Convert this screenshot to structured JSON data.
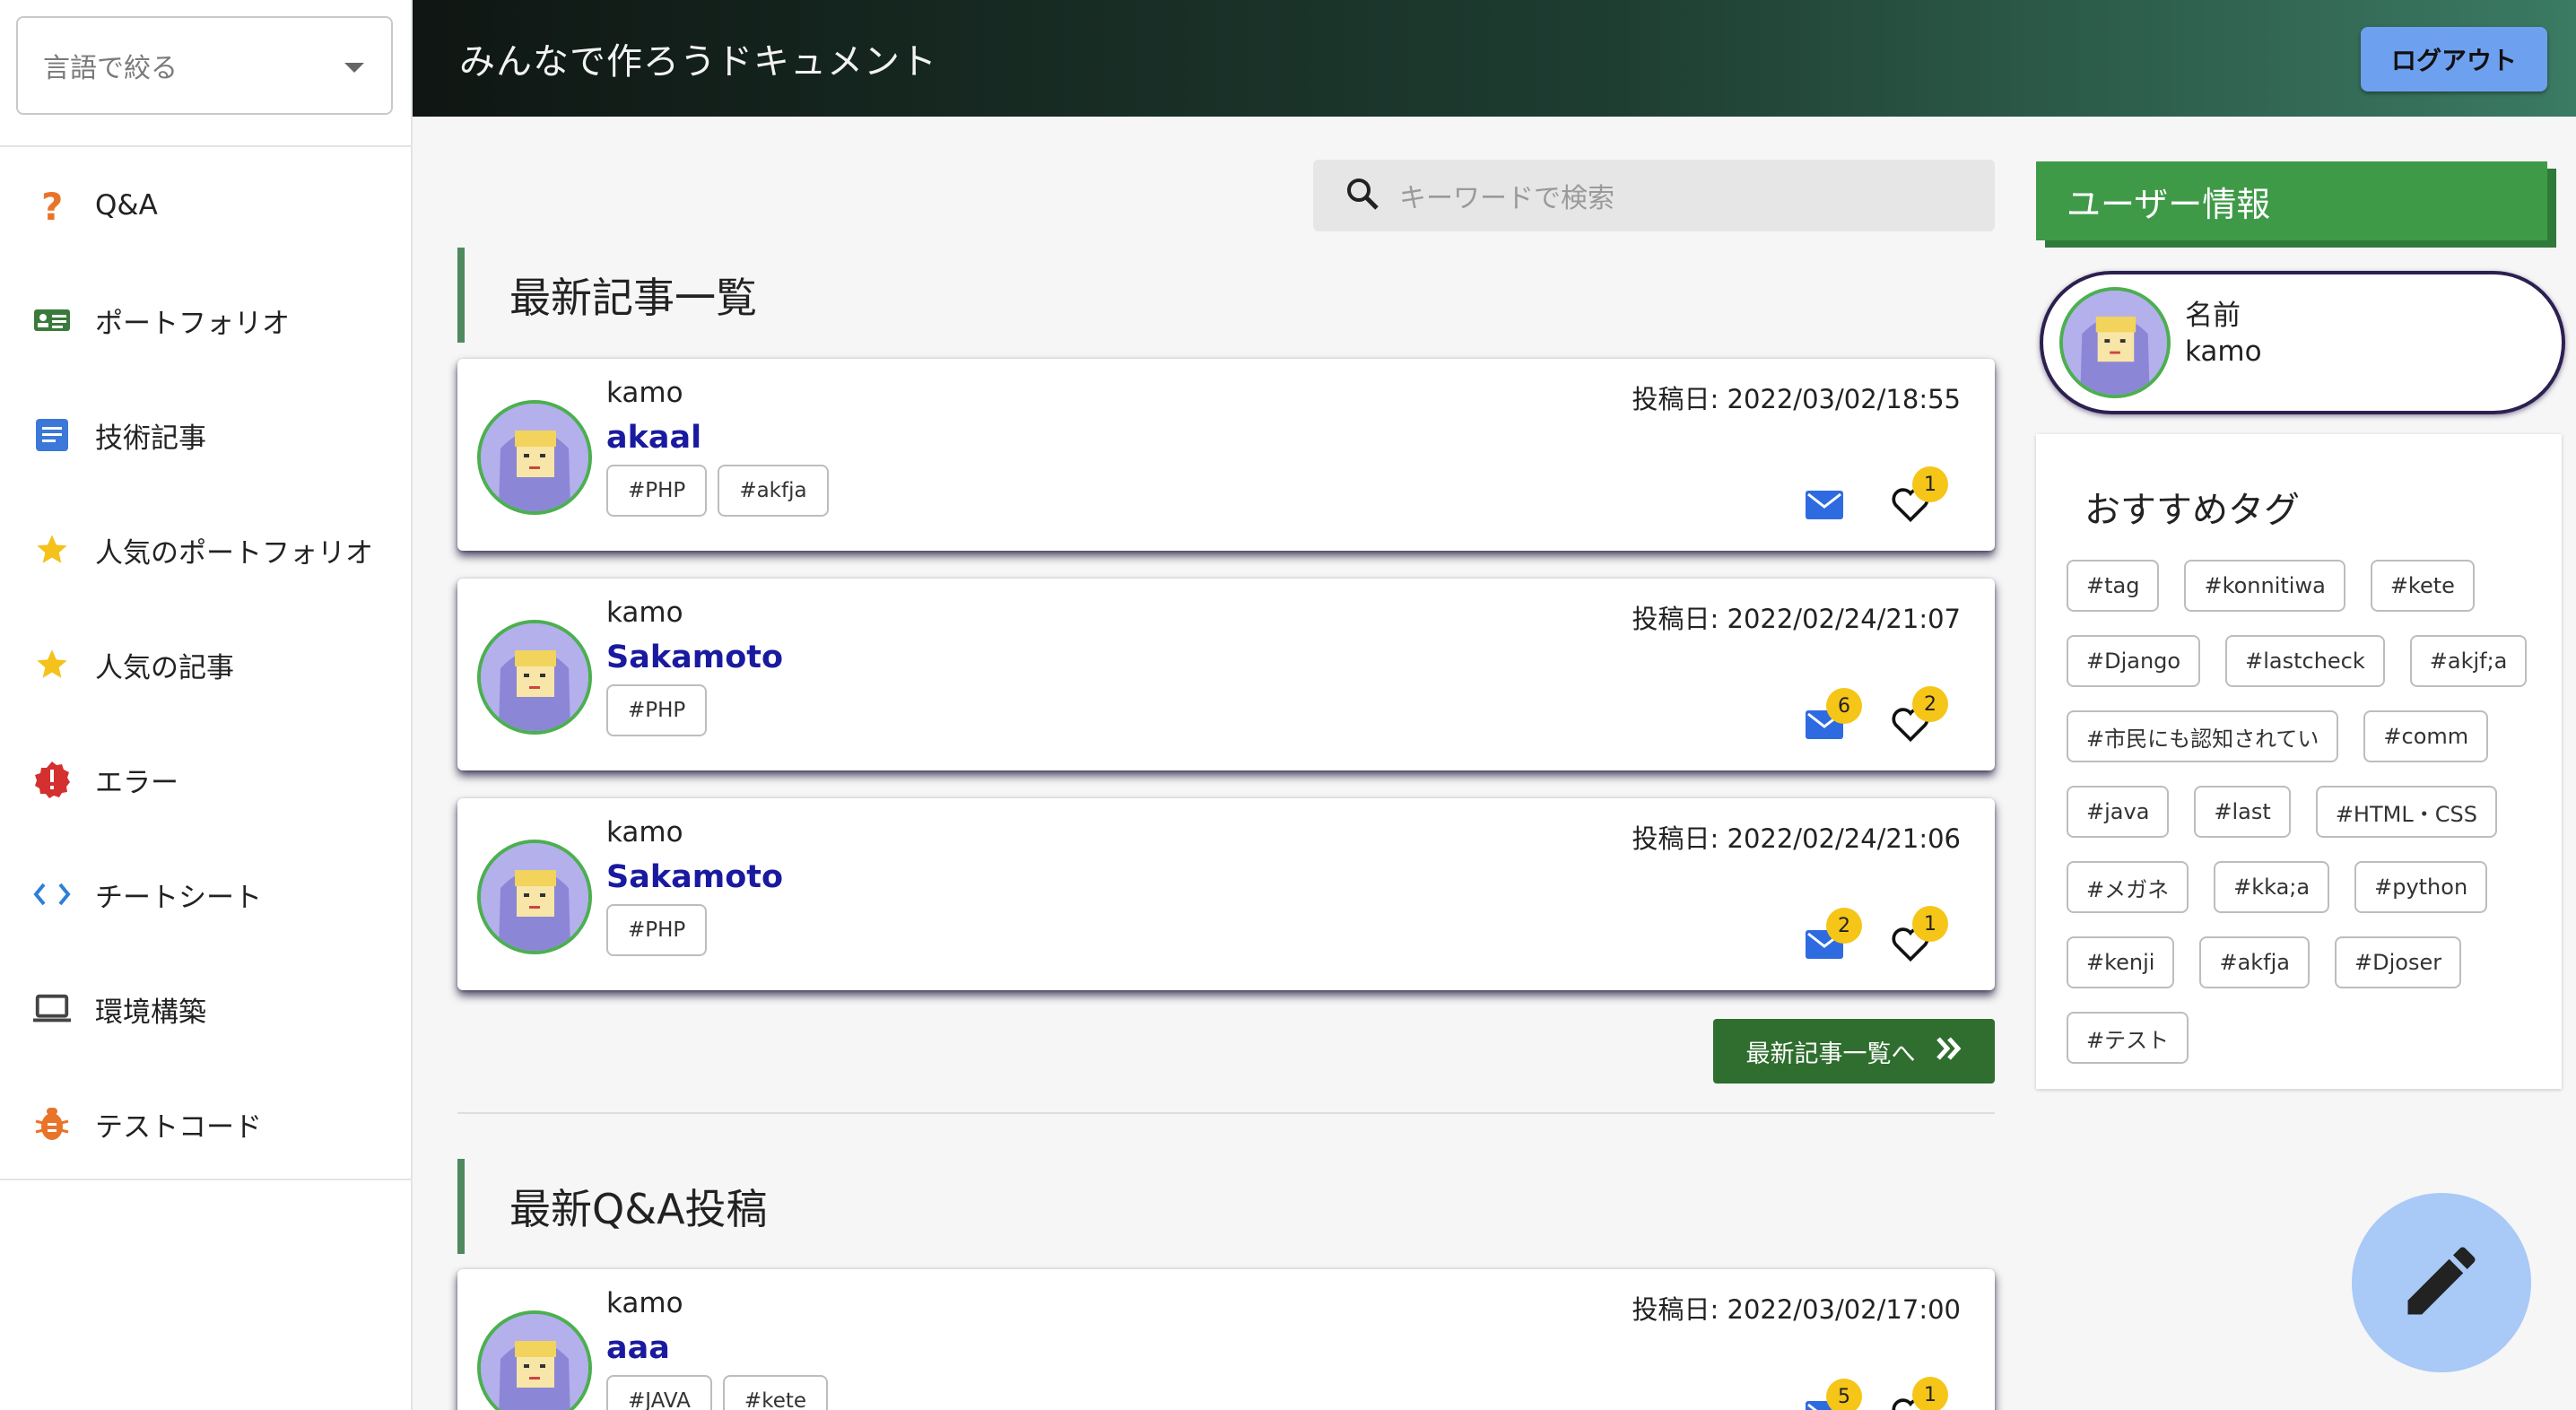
{
  "sidebar": {
    "language_filter": {
      "placeholder": "言語で絞る"
    },
    "items": [
      {
        "label": "Q&A",
        "icon": "question-icon"
      },
      {
        "label": "ポートフォリオ",
        "icon": "id-card-icon"
      },
      {
        "label": "技術記事",
        "icon": "article-icon"
      },
      {
        "label": "人気のポートフォリオ",
        "icon": "star-icon"
      },
      {
        "label": "人気の記事",
        "icon": "star-icon"
      },
      {
        "label": "エラー",
        "icon": "error-icon"
      },
      {
        "label": "チートシート",
        "icon": "code-icon"
      },
      {
        "label": "環境構築",
        "icon": "laptop-icon"
      },
      {
        "label": "テストコード",
        "icon": "bug-icon"
      }
    ]
  },
  "header": {
    "title": "みんなで作ろうドキュメント",
    "logout_label": "ログアウト"
  },
  "search": {
    "placeholder": "キーワードで検索"
  },
  "latest_articles": {
    "heading": "最新記事一覧",
    "items": [
      {
        "user": "kamo",
        "title": "akaal",
        "date": "投稿日: 2022/03/02/18:55",
        "tags": [
          "#PHP",
          "#akfja"
        ],
        "comments": "",
        "likes": "1"
      },
      {
        "user": "kamo",
        "title": "Sakamoto",
        "date": "投稿日: 2022/02/24/21:07",
        "tags": [
          "#PHP"
        ],
        "comments": "6",
        "likes": "2"
      },
      {
        "user": "kamo",
        "title": "Sakamoto",
        "date": "投稿日: 2022/02/24/21:06",
        "tags": [
          "#PHP"
        ],
        "comments": "2",
        "likes": "1"
      }
    ],
    "more_label": "最新記事一覧へ"
  },
  "latest_qa": {
    "heading": "最新Q&A投稿",
    "items": [
      {
        "user": "kamo",
        "title": "aaa",
        "date": "投稿日: 2022/03/02/17:00",
        "tags": [
          "#JAVA",
          "#kete"
        ],
        "comments": "5",
        "likes": "1"
      }
    ]
  },
  "user_info": {
    "heading": "ユーザー情報",
    "name_label": "名前",
    "name": "kamo"
  },
  "recommended_tags": {
    "heading": "おすすめタグ",
    "tags": [
      "#tag",
      "#konnitiwa",
      "#kete",
      "#Django",
      "#lastcheck",
      "#akjf;a",
      "#市民にも認知されてい",
      "#comm",
      "#java",
      "#last",
      "#HTML・CSS",
      "#メガネ",
      "#kka;a",
      "#python",
      "#kenji",
      "#akfja",
      "#Djoser",
      "#テスト"
    ]
  },
  "colors": {
    "accent_green": "#3f9a48",
    "link_blue": "#1a1aa0",
    "badge_yellow": "#f5c518",
    "logout_blue": "#6ea0f0"
  }
}
